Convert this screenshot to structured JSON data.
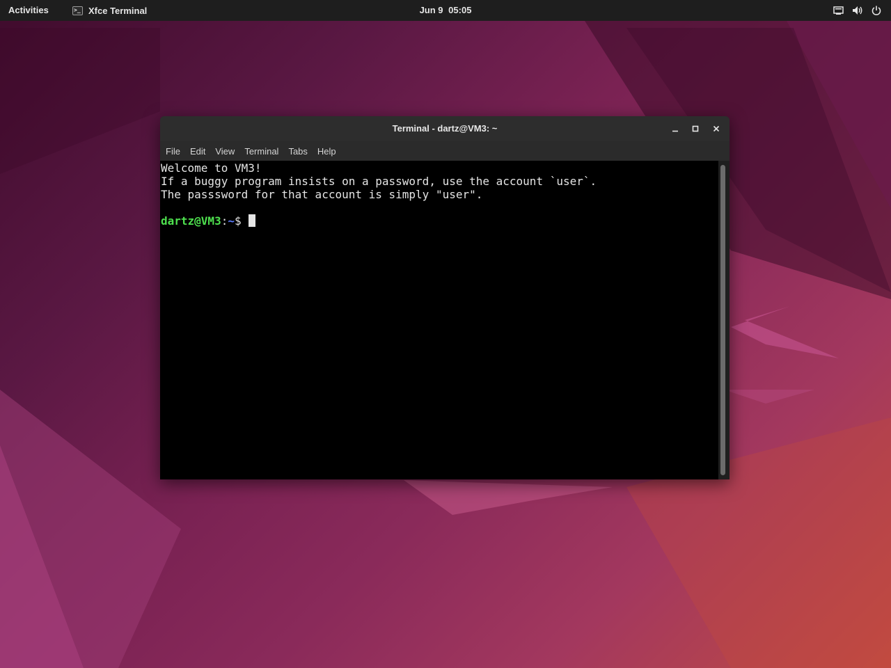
{
  "topbar": {
    "activities": "Activities",
    "app_name": "Xfce Terminal",
    "clock_date": "Jun 9",
    "clock_time": "05:05",
    "tray_icons": [
      "network-icon",
      "volume-icon",
      "power-icon"
    ]
  },
  "window": {
    "title": "Terminal - dartz@VM3: ~",
    "menu": [
      "File",
      "Edit",
      "View",
      "Terminal",
      "Tabs",
      "Help"
    ]
  },
  "terminal": {
    "lines": [
      "Welcome to VM3!",
      "If a buggy program insists on a password, use the account `user`.",
      "The passsword for that account is simply \"user\"."
    ],
    "prompt_user": "dartz@VM3",
    "prompt_sep": ":",
    "prompt_path": "~",
    "prompt_symbol": "$ "
  },
  "colors": {
    "prompt_user": "#4ee04e",
    "prompt_path": "#5c7cff",
    "terminal_bg": "#000000",
    "topbar_bg": "#1e1e1e"
  }
}
